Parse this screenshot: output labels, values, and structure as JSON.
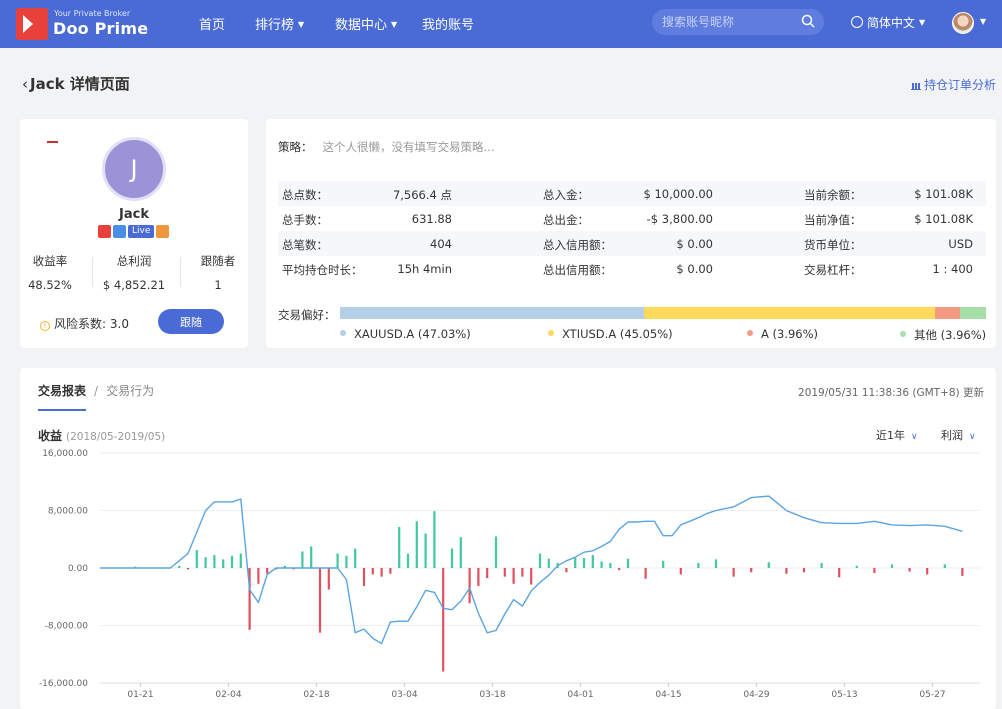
{
  "brand": {
    "tagline": "Your Private Broker",
    "name": "Doo Prime"
  },
  "nav": {
    "items": [
      {
        "label": "首页",
        "dropdown": false
      },
      {
        "label": "排行榜",
        "dropdown": true
      },
      {
        "label": "数据中心",
        "dropdown": true
      },
      {
        "label": "我的账号",
        "dropdown": false
      }
    ],
    "search_placeholder": "搜索账号昵称",
    "language": "简体中文"
  },
  "page": {
    "title": "Jack 详情页面",
    "analysis_link": "持仓订单分析"
  },
  "profile": {
    "avatar_letter": "J",
    "name": "Jack",
    "live_badge": "Live",
    "stats": [
      {
        "label": "收益率",
        "value": "48.52%"
      },
      {
        "label": "总利润",
        "value": "$ 4,852.21"
      },
      {
        "label": "跟随者",
        "value": "1"
      }
    ],
    "risk_label": "风险系数:",
    "risk_value": "3.0",
    "follow_button": "跟随"
  },
  "strategy": {
    "label": "策略：",
    "text": "这个人很懒，没有填写交易策略...",
    "rows": [
      [
        {
          "k": "总点数：",
          "v": "7,566.4 点"
        },
        {
          "k": "总入金：",
          "v": "$ 10,000.00"
        },
        {
          "k": "当前余额：",
          "v": "$ 101.08K"
        }
      ],
      [
        {
          "k": "总手数：",
          "v": "631.88"
        },
        {
          "k": "总出金：",
          "v": "-$ 3,800.00"
        },
        {
          "k": "当前净值：",
          "v": "$ 101.08K"
        }
      ],
      [
        {
          "k": "总笔数：",
          "v": "404"
        },
        {
          "k": "总入信用额：",
          "v": "$ 0.00"
        },
        {
          "k": "货币单位：",
          "v": "USD"
        }
      ],
      [
        {
          "k": "平均持仓时长：",
          "v": "15h 4min"
        },
        {
          "k": "总出信用额：",
          "v": "$ 0.00"
        },
        {
          "k": "交易杠杆：",
          "v": "1 : 400"
        }
      ]
    ],
    "preference_label": "交易偏好：",
    "preferences": [
      {
        "name": "XAUUSD.A",
        "pct_label": "(47.03%)",
        "pct": 47.03,
        "color": "#b4cfe8"
      },
      {
        "name": "XTIUSD.A",
        "pct_label": "(45.05%)",
        "pct": 45.05,
        "color": "#fdd95c"
      },
      {
        "name": "A",
        "pct_label": "(3.96%)",
        "pct": 3.96,
        "color": "#f39a82"
      },
      {
        "name": "其他",
        "pct_label": "(3.96%)",
        "pct": 3.96,
        "color": "#a6e0a8"
      }
    ]
  },
  "report": {
    "tabs": [
      {
        "label": "交易报表",
        "active": true
      },
      {
        "label": "交易行为",
        "active": false
      }
    ],
    "updated": "2019/05/31 11:38:36  (GMT+8)  更新",
    "chart_title": "收益",
    "chart_range": "(2018/05-2019/05)",
    "period_select": "近1年",
    "metric_select": "利润"
  },
  "chart_data": {
    "type": "line",
    "title": "收益",
    "subtitle": "(2018/05-2019/05)",
    "ylim": [
      -16000,
      16000
    ],
    "y_ticks": [
      "16,000.00",
      "8,000.00",
      "0.00",
      "-8,000.00",
      "-16,000.00"
    ],
    "x_ticks": [
      "01-21",
      "02-04",
      "02-18",
      "03-04",
      "03-18",
      "04-01",
      "04-15",
      "04-29",
      "05-13",
      "05-27"
    ],
    "colors": {
      "line": "#5ca4e0",
      "positive_bar": "#3ec9a0",
      "negative_bar": "#e0505f"
    },
    "line": {
      "x": [
        0,
        2,
        4,
        6,
        8,
        10,
        11,
        12,
        13,
        14,
        15,
        16,
        17,
        18,
        19,
        20,
        21,
        22,
        23,
        24,
        25,
        26,
        27,
        28,
        29,
        30,
        31,
        32,
        33,
        34,
        35,
        36,
        37,
        38,
        39,
        40,
        41,
        42,
        43,
        44,
        45,
        46,
        47,
        48,
        49,
        50,
        51,
        52,
        53,
        54,
        55,
        56,
        57,
        58,
        59,
        60,
        61,
        62,
        63,
        64,
        65,
        66,
        67,
        68,
        69,
        70,
        72,
        74,
        76,
        78,
        80,
        82,
        84,
        86,
        88,
        90,
        92,
        94,
        96,
        98
      ],
      "y": [
        0,
        0,
        0,
        0,
        0,
        2000,
        5000,
        8000,
        9200,
        9200,
        9200,
        9600,
        -3000,
        -4800,
        -900,
        0,
        0,
        0,
        0,
        0,
        0,
        0,
        0,
        -1600,
        -9000,
        -8500,
        -9800,
        -10500,
        -7500,
        -7400,
        -7400,
        -5400,
        -3100,
        -3400,
        -5600,
        -5800,
        -4600,
        -2800,
        -6300,
        -9000,
        -8700,
        -6400,
        -4400,
        -5300,
        -3200,
        -2000,
        -1000,
        300,
        1000,
        1500,
        2200,
        2400,
        3000,
        3700,
        5400,
        6400,
        6400,
        6500,
        6500,
        4500,
        4500,
        6000,
        6500,
        7000,
        7600,
        8000,
        8500,
        9800,
        10000,
        8000,
        7000,
        6300,
        6200,
        6200,
        6500,
        6000,
        5900,
        6000,
        5800,
        5100
      ]
    },
    "bars": {
      "x": [
        4,
        9,
        10,
        11,
        12,
        13,
        14,
        15,
        16,
        17,
        18,
        19,
        20,
        21,
        22,
        23,
        24,
        25,
        26,
        27,
        28,
        29,
        30,
        31,
        32,
        33,
        34,
        35,
        36,
        37,
        38,
        39,
        40,
        41,
        42,
        43,
        44,
        45,
        46,
        47,
        48,
        49,
        50,
        51,
        52,
        53,
        54,
        55,
        56,
        57,
        58,
        59,
        60,
        62,
        64,
        66,
        68,
        70,
        72,
        74,
        76,
        78,
        80,
        82,
        84,
        86,
        88,
        90,
        92,
        94,
        96,
        98
      ],
      "y": [
        200,
        300,
        -200,
        2500,
        1500,
        1800,
        1200,
        1700,
        2000,
        -8600,
        -2200,
        -800,
        -200,
        300,
        -200,
        2300,
        3000,
        -9000,
        -3000,
        2000,
        1700,
        2700,
        -2500,
        -900,
        -1200,
        -800,
        5700,
        2000,
        6500,
        4800,
        7900,
        -14400,
        2700,
        4300,
        -4900,
        -2500,
        -1400,
        4400,
        -1200,
        -2200,
        -1200,
        -2300,
        2000,
        1300,
        700,
        -600,
        1400,
        1400,
        1800,
        900,
        700,
        -300,
        1300,
        -1500,
        1000,
        -900,
        700,
        1200,
        -1200,
        -600,
        800,
        -800,
        -600,
        700,
        -1300,
        300,
        -700,
        500,
        -500,
        -900,
        500,
        -1100
      ]
    }
  }
}
